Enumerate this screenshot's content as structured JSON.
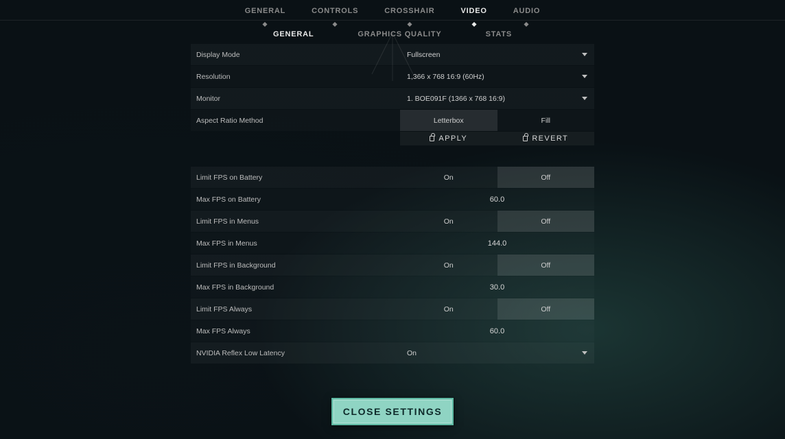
{
  "tabs": {
    "primary": [
      "GENERAL",
      "CONTROLS",
      "CROSSHAIR",
      "VIDEO",
      "AUDIO"
    ],
    "primary_active": 3,
    "secondary": [
      "GENERAL",
      "GRAPHICS QUALITY",
      "STATS"
    ],
    "secondary_active": 0
  },
  "display": {
    "mode_label": "Display Mode",
    "mode_value": "Fullscreen",
    "resolution_label": "Resolution",
    "resolution_value": "1,366 x 768 16:9 (60Hz)",
    "monitor_label": "Monitor",
    "monitor_value": "1. BOE091F (1366 x  768 16:9)",
    "aspect_label": "Aspect Ratio Method",
    "aspect_options": [
      "Letterbox",
      "Fill"
    ],
    "aspect_selected": 0
  },
  "actions": {
    "apply": "APPLY",
    "revert": "REVERT"
  },
  "fps": {
    "limit_battery_label": "Limit FPS on Battery",
    "limit_battery_selected": 1,
    "max_battery_label": "Max FPS on Battery",
    "max_battery_value": "60.0",
    "limit_menus_label": "Limit FPS in Menus",
    "limit_menus_selected": 1,
    "max_menus_label": "Max FPS in Menus",
    "max_menus_value": "144.0",
    "limit_background_label": "Limit FPS in Background",
    "limit_background_selected": 1,
    "max_background_label": "Max FPS in Background",
    "max_background_value": "30.0",
    "limit_always_label": "Limit FPS Always",
    "limit_always_selected": 1,
    "max_always_label": "Max FPS Always",
    "max_always_value": "60.0",
    "on_label": "On",
    "off_label": "Off"
  },
  "reflex": {
    "label": "NVIDIA Reflex Low Latency",
    "value": "On"
  },
  "close_label": "CLOSE SETTINGS"
}
